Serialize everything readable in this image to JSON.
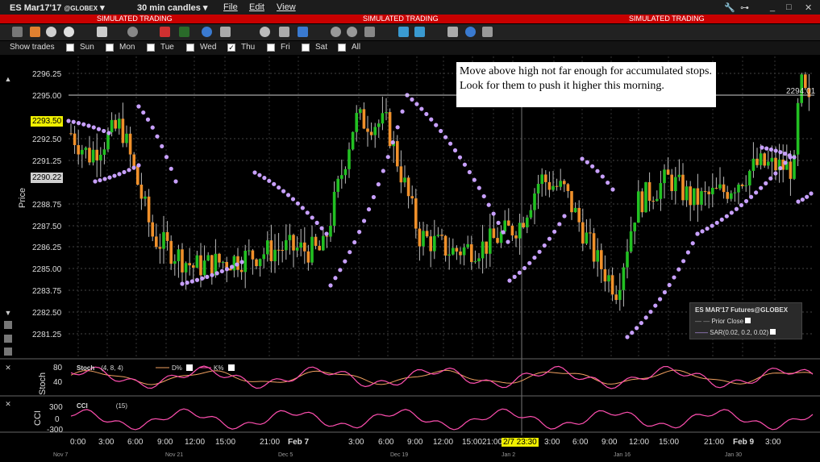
{
  "window": {
    "symbol": "ES Mar17'17",
    "exchange": "@GLOBEX",
    "interval": "30 min candles"
  },
  "menu": {
    "file": "File",
    "edit": "Edit",
    "view": "View"
  },
  "banner": "SIMULATED TRADING",
  "show_trades": {
    "label": "Show trades",
    "days": [
      {
        "name": "Sun",
        "checked": false
      },
      {
        "name": "Mon",
        "checked": false
      },
      {
        "name": "Tue",
        "checked": false
      },
      {
        "name": "Wed",
        "checked": false
      },
      {
        "name": "Thu",
        "checked": true
      },
      {
        "name": "Fri",
        "checked": false
      },
      {
        "name": "Sat",
        "checked": false
      },
      {
        "name": "All",
        "checked": false
      }
    ]
  },
  "price_axis": {
    "label": "Price",
    "ticks": [
      "2296.25",
      "2295.00",
      "2292.50",
      "2291.25",
      "2288.75",
      "2287.50",
      "2286.25",
      "2285.00",
      "2283.75",
      "2282.50",
      "2281.25"
    ]
  },
  "highlight_prices": {
    "p1": "2293.50",
    "p2": "2290.22"
  },
  "right_price_label": "2294.01",
  "annotation": "Move above high not far enough for accumulated stops. Look for them to push it higher this morning.",
  "legend": {
    "title": "ES MAR'17 Futures@GLOBEX",
    "prior_close": "Prior Close",
    "sar": "SAR(0.02, 0.2, 0.02)"
  },
  "stoch": {
    "axis_label": "Stoch",
    "name": "Stoch",
    "params": "(4, 8, 4)",
    "d_label": "D%",
    "k_label": "K%",
    "ticks": [
      "80",
      "40"
    ]
  },
  "cci": {
    "axis_label": "CCI",
    "name": "CCI",
    "params": "(15)",
    "ticks": [
      "300",
      "0",
      "-300"
    ]
  },
  "time_axis": {
    "labels": [
      "0:00",
      "3:00",
      "6:00",
      "9:00",
      "12:00",
      "15:00",
      "21:00",
      "Feb 7",
      "3:00",
      "6:00",
      "9:00",
      "12:00",
      "15:00",
      "21:00",
      "2/7 23:30",
      "3:00",
      "6:00",
      "9:00",
      "12:00",
      "15:00",
      "21:00",
      "Feb 9",
      "3:00"
    ],
    "overview": [
      "Nov 7",
      "Nov 21",
      "Dec 5",
      "Dec 19",
      "Jan 2",
      "Jan 16",
      "Jan 30"
    ]
  },
  "colors": {
    "up": "#22c022",
    "down": "#f0902a",
    "sar": "#c8a0ff",
    "banner": "#c80000",
    "k": "#ff4fb0",
    "d": "#f0a060"
  }
}
